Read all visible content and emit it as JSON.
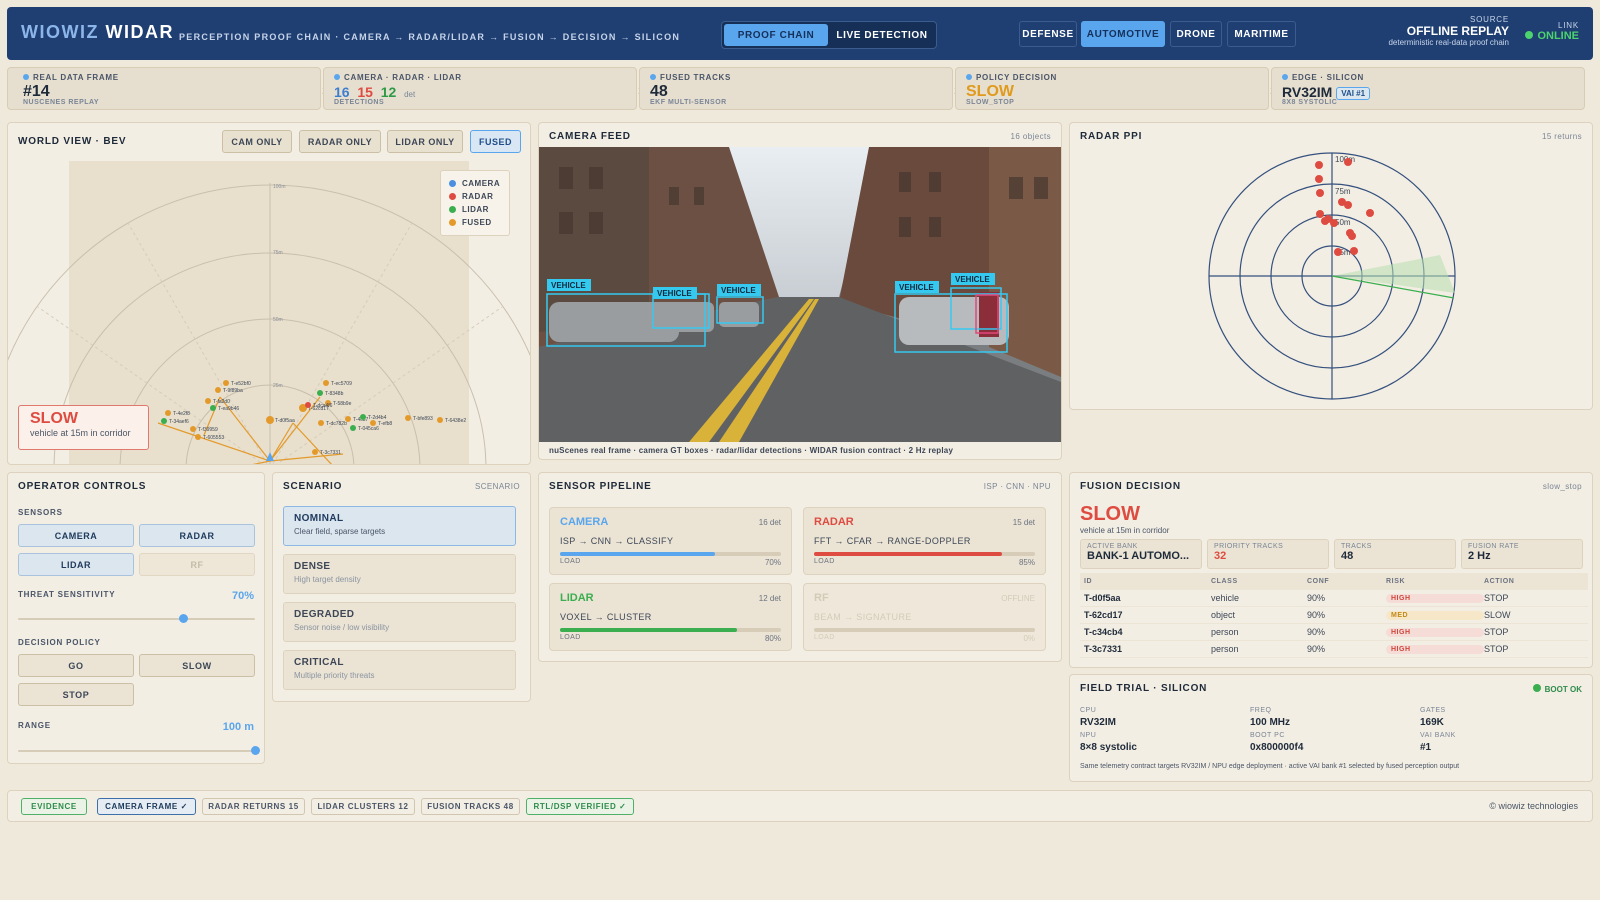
{
  "header": {
    "brand_a": "WIOWIZ",
    "brand_b": "WIDAR",
    "subtitle": "PERCEPTION PROOF CHAIN · CAMERA → RADAR/LIDAR → FUSION → DECISION → SILICON",
    "modes": [
      "PROOF CHAIN",
      "LIVE DETECTION"
    ],
    "domains": [
      "DEFENSE",
      "AUTOMOTIVE",
      "DRONE",
      "MARITIME"
    ],
    "source_label": "SOURCE",
    "source_value": "OFFLINE REPLAY",
    "source_sub": "deterministic real-data proof chain",
    "link_label": "LINK",
    "link_value": "ONLINE"
  },
  "stages": [
    {
      "label": "REAL DATA FRAME",
      "value": "#14",
      "sub": "NUSCENES REPLAY"
    },
    {
      "label": "CAMERA · RADAR · LIDAR",
      "cam": "16",
      "radar": "15",
      "lidar": "12",
      "det": "det",
      "sub": "DETECTIONS"
    },
    {
      "label": "FUSED TRACKS",
      "value": "48",
      "sub": "EKF MULTI-SENSOR"
    },
    {
      "label": "POLICY DECISION",
      "value": "SLOW",
      "sub": "SLOW_STOP"
    },
    {
      "label": "EDGE · SILICON",
      "value": "RV32IM",
      "badge": "VAI #1",
      "sub": "8X8 SYSTOLIC"
    }
  ],
  "world": {
    "title": "WORLD VIEW · BEV",
    "views": [
      "CAM ONLY",
      "RADAR ONLY",
      "LIDAR ONLY",
      "FUSED"
    ],
    "legend": [
      "CAMERA",
      "RADAR",
      "LIDAR",
      "FUSED"
    ],
    "rings": [
      "100m",
      "75m",
      "50m",
      "25m"
    ],
    "decision": "SLOW",
    "reason": "vehicle at 15m in corridor",
    "tracks": [
      "T-e52bf0",
      "T-9f89ba",
      "T-fa2d0",
      "T-ea9b46",
      "T-4e2f8",
      "T-34aef6",
      "T-f39959",
      "T-605553",
      "T-d0f5aa",
      "T-62cd17",
      "T-dc782b",
      "T-ec5709",
      "T-8348b",
      "T-58b9e",
      "T-dca4f6",
      "T-efb8",
      "T-4c87",
      "T-2d4b4",
      "T-bfe893",
      "T-6438e2",
      "T-045ca6",
      "T-3c7331"
    ]
  },
  "camera": {
    "title": "CAMERA FEED",
    "meta": "16 objects",
    "label": "VEHICLE",
    "caption": "nuScenes real frame · camera GT boxes · radar/lidar detections · WIDAR fusion contract · 2 Hz replay"
  },
  "radar": {
    "title": "RADAR PPI",
    "meta": "15 returns",
    "rings": [
      "100m",
      "75m",
      "50m",
      "25m"
    ]
  },
  "controls": {
    "title": "OPERATOR CONTROLS",
    "sensors_label": "SENSORS",
    "sensors": [
      "CAMERA",
      "RADAR",
      "LIDAR",
      "RF"
    ],
    "threat_label": "THREAT SENSITIVITY",
    "threat_value": "70%",
    "threat_level": 0.7,
    "policy_label": "DECISION POLICY",
    "policies": [
      "GO",
      "SLOW",
      "STOP"
    ],
    "range_label": "RANGE",
    "range_value": "100 m",
    "range_level": 1.0
  },
  "scenario": {
    "title": "SCENARIO",
    "meta": "SCENARIO",
    "items": [
      {
        "t": "NOMINAL",
        "s": "Clear field, sparse targets"
      },
      {
        "t": "DENSE",
        "s": "High target density"
      },
      {
        "t": "DEGRADED",
        "s": "Sensor noise / low visibility"
      },
      {
        "t": "CRITICAL",
        "s": "Multiple priority threats"
      }
    ]
  },
  "pipeline": {
    "title": "SENSOR PIPELINE",
    "meta": "ISP · CNN · NPU",
    "cards": [
      {
        "name": "CAMERA",
        "det": "16 det",
        "path": "ISP → CNN → CLASSIFY",
        "load": "LOAD",
        "pct": "70%",
        "level": 0.7,
        "color": "#5aa6ee"
      },
      {
        "name": "RADAR",
        "det": "15 det",
        "path": "FFT → CFAR → RANGE-DOPPLER",
        "load": "LOAD",
        "pct": "85%",
        "level": 0.85,
        "color": "#de4b41"
      },
      {
        "name": "LIDAR",
        "det": "12 det",
        "path": "VOXEL → CLUSTER",
        "load": "LOAD",
        "pct": "80%",
        "level": 0.8,
        "color": "#3bae4f"
      },
      {
        "name": "RF",
        "det": "OFFLINE",
        "path": "BEAM → SIGNATURE",
        "load": "LOAD",
        "pct": "0%",
        "level": 0,
        "color": "#ccc"
      }
    ]
  },
  "fusion": {
    "title": "FUSION DECISION",
    "meta": "slow_stop",
    "decision": "SLOW",
    "reason": "vehicle at 15m in corridor",
    "metrics": [
      {
        "k": "ACTIVE BANK",
        "v": "BANK-1 AUTOMO..."
      },
      {
        "k": "PRIORITY TRACKS",
        "v": "32"
      },
      {
        "k": "TRACKS",
        "v": "48"
      },
      {
        "k": "FUSION RATE",
        "v": "2 Hz"
      }
    ],
    "cols": [
      "ID",
      "CLASS",
      "CONF",
      "RISK",
      "ACTION"
    ],
    "rows": [
      {
        "id": "T-d0f5aa",
        "cls": "vehicle",
        "conf": "90%",
        "risk": "HIGH",
        "act": "STOP"
      },
      {
        "id": "T-62cd17",
        "cls": "object",
        "conf": "90%",
        "risk": "MED",
        "act": "SLOW"
      },
      {
        "id": "T-c34cb4",
        "cls": "person",
        "conf": "90%",
        "risk": "HIGH",
        "act": "STOP"
      },
      {
        "id": "T-3c7331",
        "cls": "person",
        "conf": "90%",
        "risk": "HIGH",
        "act": "STOP"
      }
    ]
  },
  "field": {
    "title": "FIELD TRIAL · SILICON",
    "status": "BOOT OK",
    "kv": [
      {
        "k": "CPU",
        "v": "RV32IM"
      },
      {
        "k": "FREQ",
        "v": "100 MHz"
      },
      {
        "k": "GATES",
        "v": "169K"
      },
      {
        "k": "NPU",
        "v": "8×8 systolic"
      },
      {
        "k": "BOOT PC",
        "v": "0x800000f4"
      },
      {
        "k": "VAI BANK",
        "v": "#1"
      }
    ],
    "note": "Same telemetry contract targets RV32IM / NPU edge deployment · active VAI bank #1 selected by fused perception output"
  },
  "footer": {
    "tags": [
      "EVIDENCE",
      "CAMERA FRAME ✓",
      "RADAR RETURNS 15",
      "LIDAR CLUSTERS 12",
      "FUSION TRACKS 48",
      "RTL/DSP VERIFIED ✓"
    ],
    "copy": "© wiowiz technologies"
  }
}
